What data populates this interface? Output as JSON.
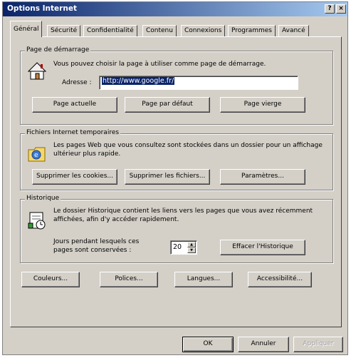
{
  "window": {
    "title": "Options Internet",
    "help_label": "?",
    "close_label": "×"
  },
  "tabs": [
    {
      "label": "Général"
    },
    {
      "label": "Sécurité"
    },
    {
      "label": "Confidentialité"
    },
    {
      "label": "Contenu"
    },
    {
      "label": "Connexions"
    },
    {
      "label": "Programmes"
    },
    {
      "label": "Avancé"
    }
  ],
  "home": {
    "legend": "Page de démarrage",
    "description": "Vous pouvez choisir la page à utiliser comme page de démarrage.",
    "address_label": "Adresse :",
    "address_value": "http://www.google.fr/",
    "buttons": {
      "current": "Page actuelle",
      "default": "Page par défaut",
      "blank": "Page vierge"
    }
  },
  "temp": {
    "legend": "Fichiers Internet temporaires",
    "description": "Les pages Web que vous consultez sont stockées dans un dossier pour un affichage ultérieur plus rapide.",
    "buttons": {
      "cookies": "Supprimer les cookies...",
      "files": "Supprimer les fichiers...",
      "settings": "Paramètres..."
    }
  },
  "history": {
    "legend": "Historique",
    "description": "Le dossier Historique contient les liens vers les pages que vous avez récemment affichées, afin d'y accéder rapidement.",
    "days_label": "Jours pendant lesquels ces pages sont conservées :",
    "days_value": "20",
    "clear_button": "Effacer l'Historique"
  },
  "bottom_buttons": {
    "colors": "Couleurs...",
    "fonts": "Polices...",
    "languages": "Langues...",
    "accessibility": "Accessibilité..."
  },
  "dialog_buttons": {
    "ok": "OK",
    "cancel": "Annuler",
    "apply": "Appliquer"
  }
}
